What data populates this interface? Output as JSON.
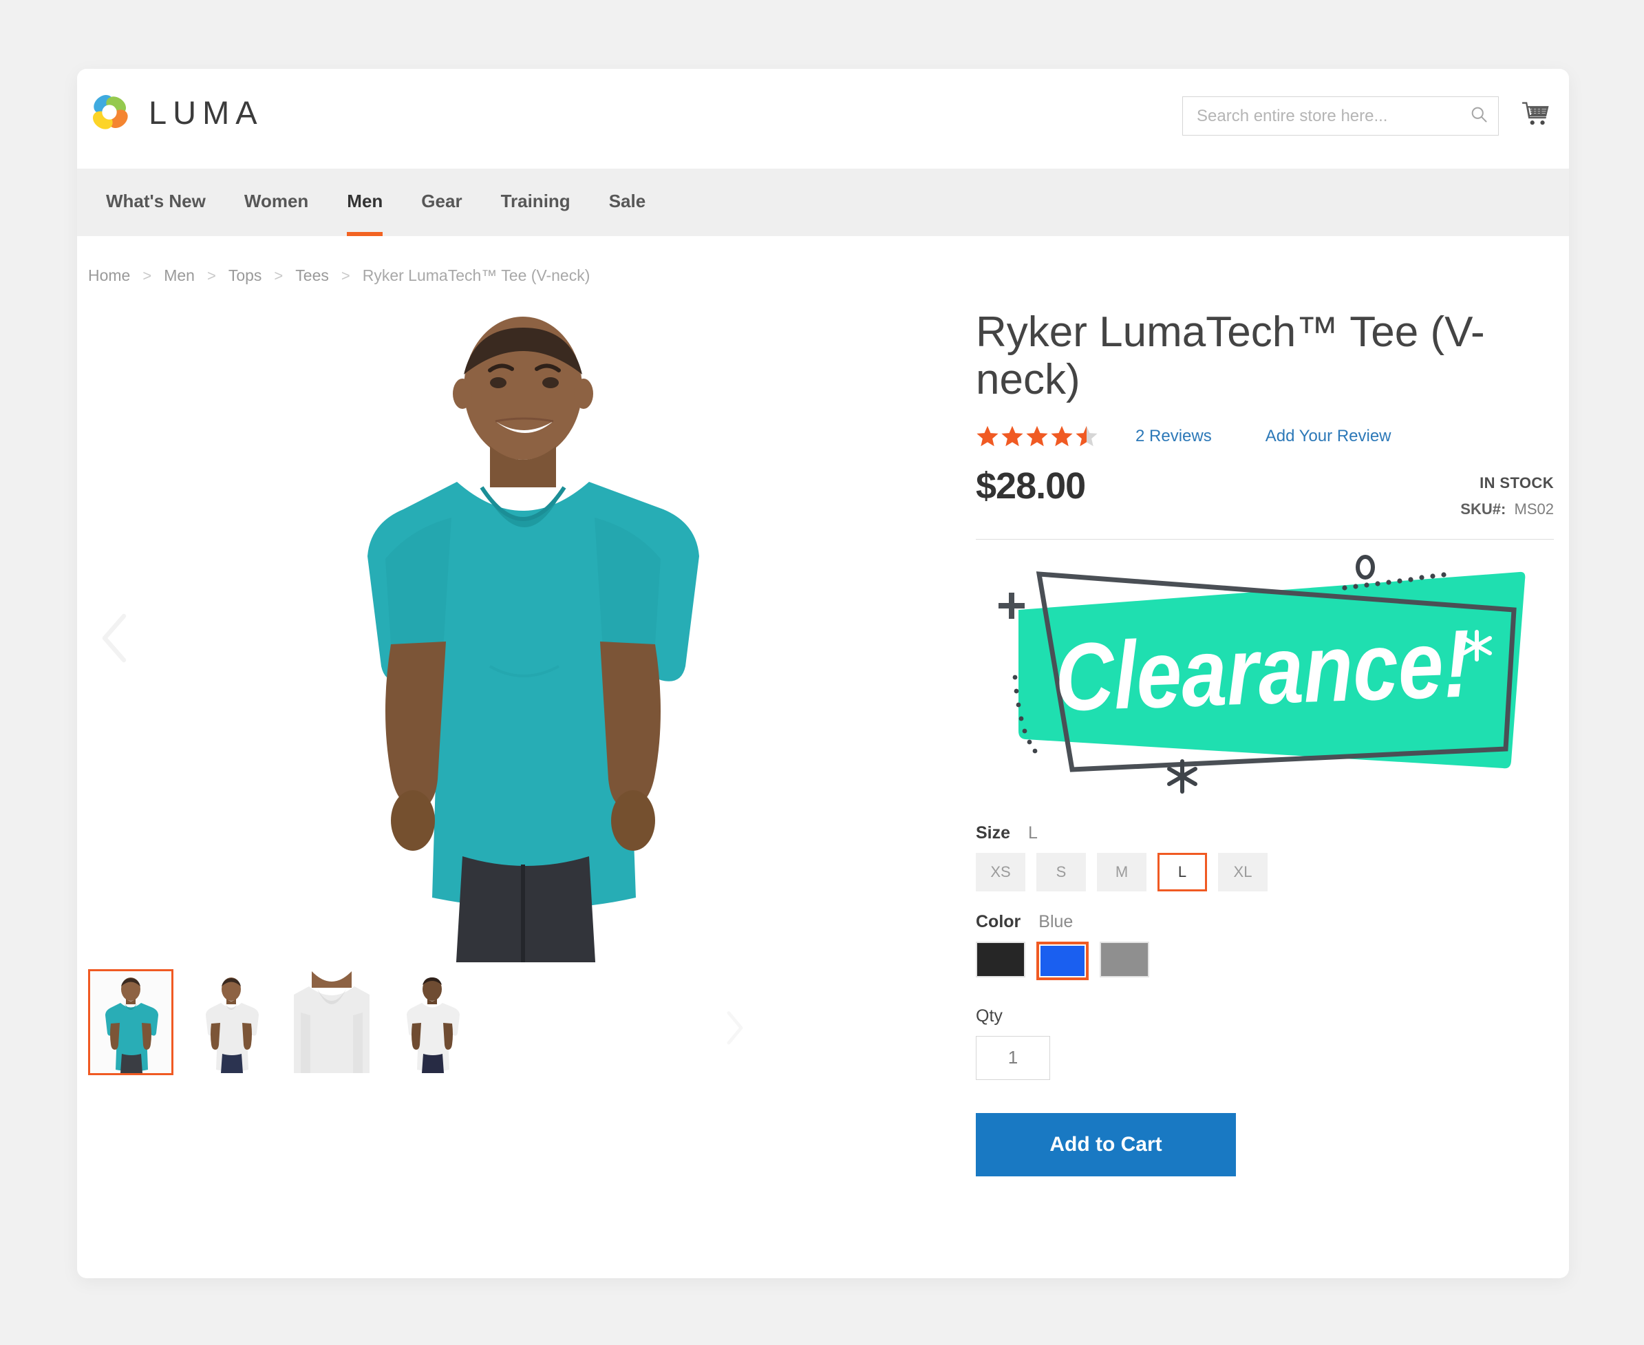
{
  "header": {
    "brand_name": "LUMA",
    "logo_icon": "luma-flower-logo",
    "search": {
      "placeholder": "Search entire store here...",
      "value": "",
      "icon": "search-icon"
    },
    "cart_icon": "shopping-cart-icon"
  },
  "nav": {
    "items": [
      {
        "label": "What's New",
        "active": false
      },
      {
        "label": "Women",
        "active": false
      },
      {
        "label": "Men",
        "active": true
      },
      {
        "label": "Gear",
        "active": false
      },
      {
        "label": "Training",
        "active": false
      },
      {
        "label": "Sale",
        "active": false
      }
    ],
    "active_accent": "#f26322"
  },
  "breadcrumb": {
    "separator": ">",
    "items": [
      {
        "label": "Home"
      },
      {
        "label": "Men"
      },
      {
        "label": "Tops"
      },
      {
        "label": "Tees"
      }
    ],
    "current": "Ryker LumaTech™ Tee (V-neck)"
  },
  "gallery": {
    "prev_arrow_icon": "chevron-left-icon",
    "next_arrow_icon": "chevron-right-icon",
    "main_image_alt": "Man wearing blue Ryker LumaTech V-neck tee",
    "thumbnails": [
      {
        "alt": "Blue tee front view",
        "selected": true,
        "shirt_color": "#29adb6"
      },
      {
        "alt": "White tee front view",
        "selected": false,
        "shirt_color": "#eeeeee"
      },
      {
        "alt": "White tee close-up detail",
        "selected": false,
        "shirt_color": "#e9e9e9"
      },
      {
        "alt": "White tee back view",
        "selected": false,
        "shirt_color": "#ededed"
      }
    ],
    "selected_border_color": "#f05a23"
  },
  "product": {
    "title": "Ryker LumaTech™ Tee (V-neck)",
    "rating": {
      "value": 4.5,
      "max": 5,
      "star_color": "#f05a23",
      "empty_star_color": "#d6d6d6"
    },
    "reviews_link": "2 Reviews",
    "add_review_link": "Add Your Review",
    "price": "$28.00",
    "stock_status": "IN STOCK",
    "sku_label": "SKU#:",
    "sku_value": "MS02",
    "promo_banner": {
      "text": "Clearance!",
      "background_color": "#1fdfb0",
      "outline_color": "#4a4f55",
      "text_color": "#ffffff",
      "icon": "clearance-badge"
    },
    "options": {
      "size": {
        "label": "Size",
        "selected": "L",
        "values": [
          {
            "label": "XS",
            "selected": false
          },
          {
            "label": "S",
            "selected": false
          },
          {
            "label": "M",
            "selected": false
          },
          {
            "label": "L",
            "selected": true
          },
          {
            "label": "XL",
            "selected": false
          }
        ]
      },
      "color": {
        "label": "Color",
        "selected": "Blue",
        "values": [
          {
            "name": "Black",
            "hex": "#262626",
            "selected": false
          },
          {
            "name": "Blue",
            "hex": "#1a5ff0",
            "selected": true
          },
          {
            "name": "Gray",
            "hex": "#8f8f8f",
            "selected": false
          }
        ]
      }
    },
    "qty": {
      "label": "Qty",
      "value": "1"
    },
    "add_to_cart_label": "Add to Cart",
    "add_to_cart_color": "#1979c3"
  }
}
